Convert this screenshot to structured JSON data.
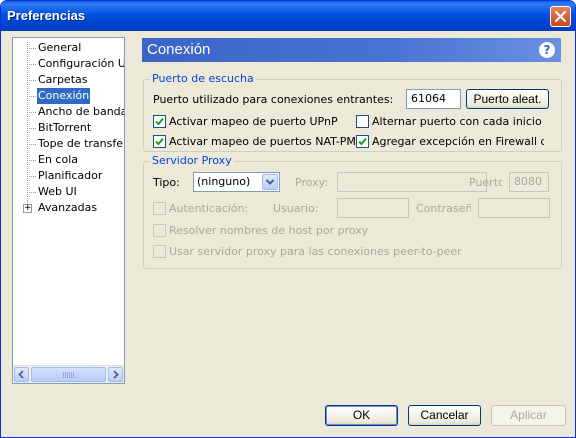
{
  "window": {
    "title": "Preferencias"
  },
  "sidebar": {
    "items": [
      {
        "label": "General"
      },
      {
        "label": "Configuración UI"
      },
      {
        "label": "Carpetas"
      },
      {
        "label": "Conexión"
      },
      {
        "label": "Ancho de banda"
      },
      {
        "label": "BitTorrent"
      },
      {
        "label": "Tope de transferencia"
      },
      {
        "label": "En cola"
      },
      {
        "label": "Planificador"
      },
      {
        "label": "Web UI"
      },
      {
        "label": "Avanzadas"
      }
    ],
    "expander_symbol": "+"
  },
  "header": {
    "title": "Conexión",
    "help_symbol": "?"
  },
  "listen_port": {
    "group_title": "Puerto de escucha",
    "port_label": "Puerto utilizado para conexiones entrantes:",
    "port_value": "61064",
    "random_button": "Puerto aleat.",
    "upnp": {
      "label": "Activar mapeo de puerto UPnP",
      "checked": true
    },
    "alternate": {
      "label": "Alternar puerto con cada inicio",
      "checked": false
    },
    "natpmp": {
      "label": "Activar mapeo de puertos NAT-PMP",
      "checked": true
    },
    "firewall": {
      "label": "Agregar excepción en Firewall de Windows",
      "checked": true
    }
  },
  "proxy": {
    "group_title": "Servidor Proxy",
    "type_label": "Tipo:",
    "type_value": "(ninguno)",
    "proxy_label": "Proxy:",
    "proxy_value": "",
    "port_label": "Puerto:",
    "port_value": "8080",
    "auth_label": "Autenticación:",
    "user_label": "Usuario:",
    "user_value": "",
    "password_label": "Contraseña:",
    "password_value": "",
    "resolve_hostnames": "Resolver nombres de host por proxy",
    "peer_to_peer": "Usar servidor proxy para las conexiones peer-to-peer"
  },
  "footer": {
    "ok": "OK",
    "cancel": "Cancelar",
    "apply": "Aplicar"
  }
}
